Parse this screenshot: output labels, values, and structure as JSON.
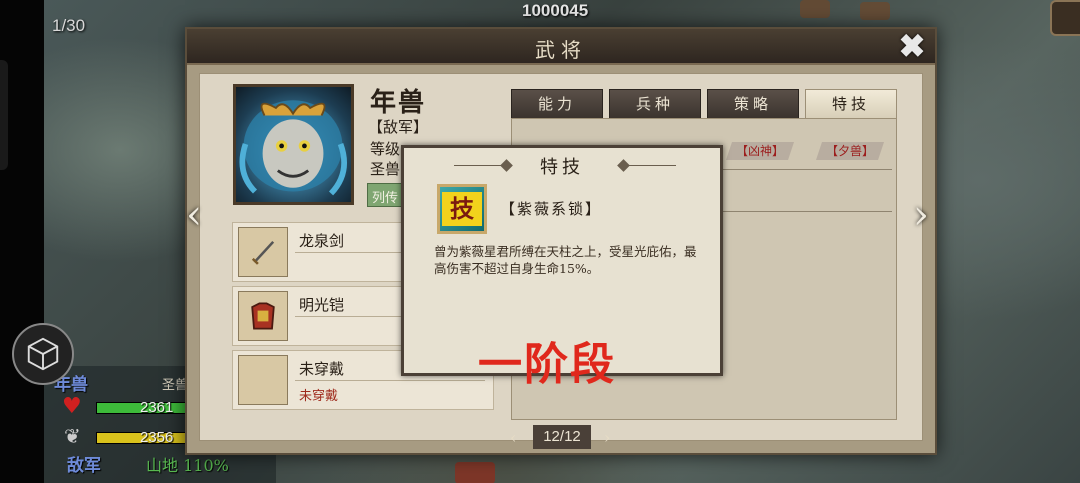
{
  "hud": {
    "turn": "1/30",
    "gold": "1000045"
  },
  "unit_info": {
    "name": "年兽",
    "type": "圣兽",
    "hp": "2361",
    "hp_pct": 0.98,
    "mp": "2356",
    "mp_pct": 0.98,
    "side": "敌军",
    "terrain": "山地 110%"
  },
  "dialog": {
    "title": "武将",
    "close_icon": "close-icon",
    "prev_icon": "chevron-left-icon",
    "next_icon": "chevron-right-icon"
  },
  "general": {
    "name": "年兽",
    "faction": "【敌军】",
    "level_label": "等级",
    "class_label": "圣兽",
    "list_button": "列传"
  },
  "equipment": [
    {
      "name": "龙泉剑",
      "sub": "",
      "icon": "sword-icon"
    },
    {
      "name": "明光铠",
      "sub": "",
      "icon": "armor-icon"
    },
    {
      "name": "未穿戴",
      "sub": "未穿戴",
      "icon": "empty-slot-icon"
    }
  ],
  "tabs": [
    {
      "label": "能力",
      "active": false
    },
    {
      "label": "兵种",
      "active": false
    },
    {
      "label": "策略",
      "active": false
    },
    {
      "label": "特技",
      "active": true
    }
  ],
  "skill_tags": [
    "【凶神】",
    "【夕兽】"
  ],
  "pager": {
    "current": "12/12",
    "prev_icon": "chevron-left-icon",
    "next_icon": "chevron-right-icon"
  },
  "popup": {
    "title": "特技",
    "icon_glyph": "技",
    "skill_name": "【紫薇系锁】",
    "description": "曾为紫薇星君所缚在天柱之上，受星光庇佑，最高伤害不超过自身生命15%。"
  },
  "annotation": {
    "stage": "一阶段"
  },
  "colors": {
    "accent_red": "#e0281c",
    "hp_green": "#3dbb3a",
    "mp_yellow": "#d9c21c",
    "enemy_blue": "#6e8bd9"
  }
}
